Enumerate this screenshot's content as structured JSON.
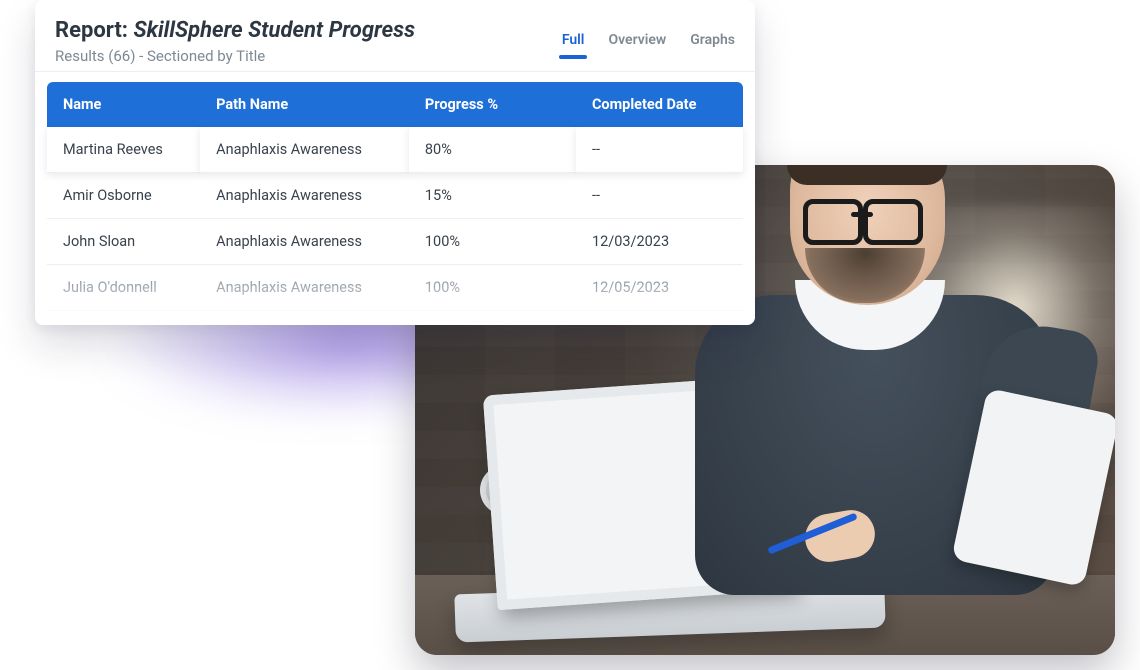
{
  "report": {
    "prefix": "Report: ",
    "title_italic": "SkillSphere Student Progress",
    "results_label": "Results (66) - Sectioned by Title"
  },
  "tabs": [
    {
      "label": "Full",
      "active": true
    },
    {
      "label": "Overview",
      "active": false
    },
    {
      "label": "Graphs",
      "active": false
    }
  ],
  "table": {
    "headers": {
      "name": "Name",
      "path": "Path Name",
      "progress": "Progress %",
      "completed": "Completed Date"
    },
    "rows": [
      {
        "name": "Martina Reeves",
        "path": "Anaphlaxis Awareness",
        "progress": "80%",
        "completed": "--"
      },
      {
        "name": "Amir Osborne",
        "path": "Anaphlaxis Awareness",
        "progress": "15%",
        "completed": "--"
      },
      {
        "name": "John Sloan",
        "path": "Anaphlaxis Awareness",
        "progress": "100%",
        "completed": "12/03/2023"
      },
      {
        "name": "Julia O'donnell",
        "path": "Anaphlaxis Awareness",
        "progress": "100%",
        "completed": "12/05/2023"
      }
    ]
  },
  "colors": {
    "tab_active": "#1b62d6",
    "header_bg": "#1f6fd8",
    "glow": "#6c4cd6"
  }
}
